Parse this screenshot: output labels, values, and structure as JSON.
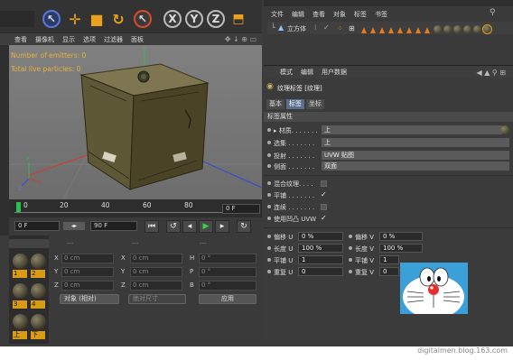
{
  "left_toolbar": {
    "tools": [
      "X",
      "Y",
      "Z"
    ]
  },
  "viewport": {
    "menu": [
      "查看",
      "摄像机",
      "显示",
      "选项",
      "过滤器",
      "面板"
    ],
    "info": {
      "emitters": "Number of emitters: 0",
      "particles": "Total live particles: 0"
    }
  },
  "timeline": {
    "ticks": [
      "0",
      "20",
      "40",
      "60",
      "80"
    ],
    "frame_field": "0 F"
  },
  "transport": {
    "current": "0 F",
    "end": "90 F"
  },
  "material_manager": {
    "labels": [
      "1",
      "2",
      "3",
      "4",
      "上",
      "下"
    ]
  },
  "coords": {
    "headers": [
      "---",
      "---",
      "---"
    ],
    "rows": [
      {
        "a": "X",
        "av": "0 cm",
        "b": "X",
        "bv": "0 cm",
        "c": "H",
        "cv": "0 °"
      },
      {
        "a": "Y",
        "av": "0 cm",
        "b": "Y",
        "bv": "0 cm",
        "c": "P",
        "cv": "0 °"
      },
      {
        "a": "Z",
        "av": "0 cm",
        "b": "Z",
        "bv": "0 cm",
        "c": "B",
        "cv": "0 °"
      }
    ],
    "mode": "对象 (相对)",
    "size_mode": "绝对尺寸",
    "apply": "应用"
  },
  "object_manager": {
    "menu": [
      "文件",
      "编辑",
      "查看",
      "对象",
      "标签",
      "书签"
    ],
    "object_name": "立方体"
  },
  "attributes": {
    "menu": [
      "模式",
      "编辑",
      "用户数据"
    ],
    "title": "纹理标签 [纹理]",
    "tabs": [
      "基本",
      "标签",
      "坐标"
    ],
    "section": "标签属性",
    "rows": [
      {
        "label": "▸ 材质. . . . . . .",
        "value": "上"
      },
      {
        "label": "选集 . . . . . . .",
        "value": "上"
      },
      {
        "label": "投射 . . . . . . .",
        "value": "UVW 贴图"
      },
      {
        "label": "侧面 . . . . . . .",
        "value": "双面"
      }
    ],
    "checks": [
      {
        "label": "混合纹理. . . .",
        "checked": false
      },
      {
        "label": "平铺 . . . . . . .",
        "checked": true
      },
      {
        "label": "连续 . . . . . . .",
        "checked": false
      },
      {
        "label": "使用凹凸 UVW",
        "checked": true
      }
    ],
    "offsets": [
      {
        "l1": "偏移 U",
        "v1": "0 %",
        "l2": "偏移 V",
        "v2": "0 %"
      },
      {
        "l1": "长度 U",
        "v1": "100 %",
        "l2": "长度 V",
        "v2": "100 %"
      },
      {
        "l1": "平铺 U",
        "v1": "1",
        "l2": "平铺 V",
        "v2": "1"
      },
      {
        "l1": "重复 U",
        "v1": "0",
        "l2": "重复 V",
        "v2": "0"
      }
    ]
  },
  "watermark": "digitalmen.blog.163.com"
}
